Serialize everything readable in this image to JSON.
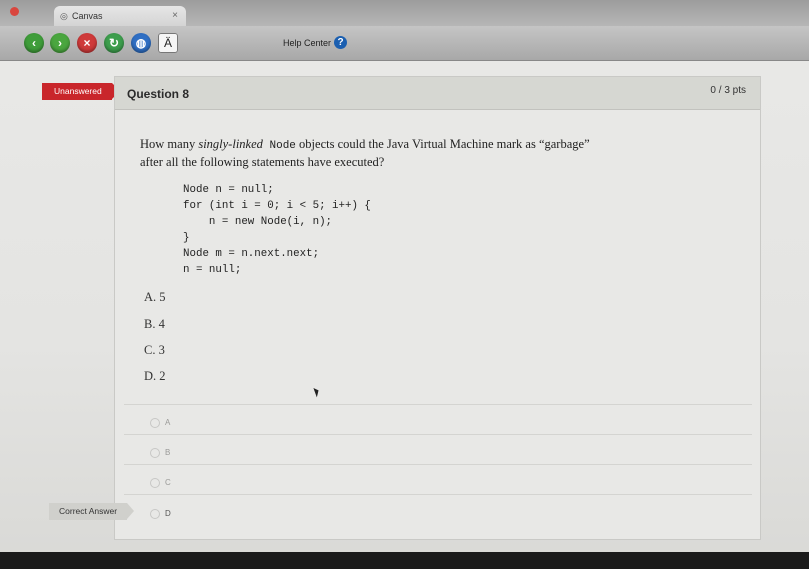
{
  "browser": {
    "tab_title": "Canvas",
    "tab_close": "×",
    "help_label": "Help Center",
    "help_icon_glyph": "?",
    "toolbar_square_glyph": "Ä"
  },
  "quiz": {
    "status_flag": "Unanswered",
    "question_title": "Question 8",
    "points": "0 / 3 pts",
    "question_part1": "How many ",
    "question_italic": "singly-linked",
    "question_code": " Node",
    "question_part2": " objects could the Java Virtual Machine mark as “garbage” after all the following statements have executed?",
    "code_lines": [
      "Node n = null;",
      "for (int i = 0; i < 5; i++) {",
      "    n = new Node(i, n);",
      "}",
      "Node m = n.next.next;",
      "n = null;"
    ],
    "choices": [
      "A. 5",
      "B. 4",
      "C. 3",
      "D. 2"
    ],
    "radio_options": [
      "A",
      "B",
      "C",
      "D"
    ],
    "correct_answer_label": "Correct Answer"
  },
  "colors": {
    "unanswered_flag": "#c9262b",
    "help_icon": "#1b5fb0"
  }
}
